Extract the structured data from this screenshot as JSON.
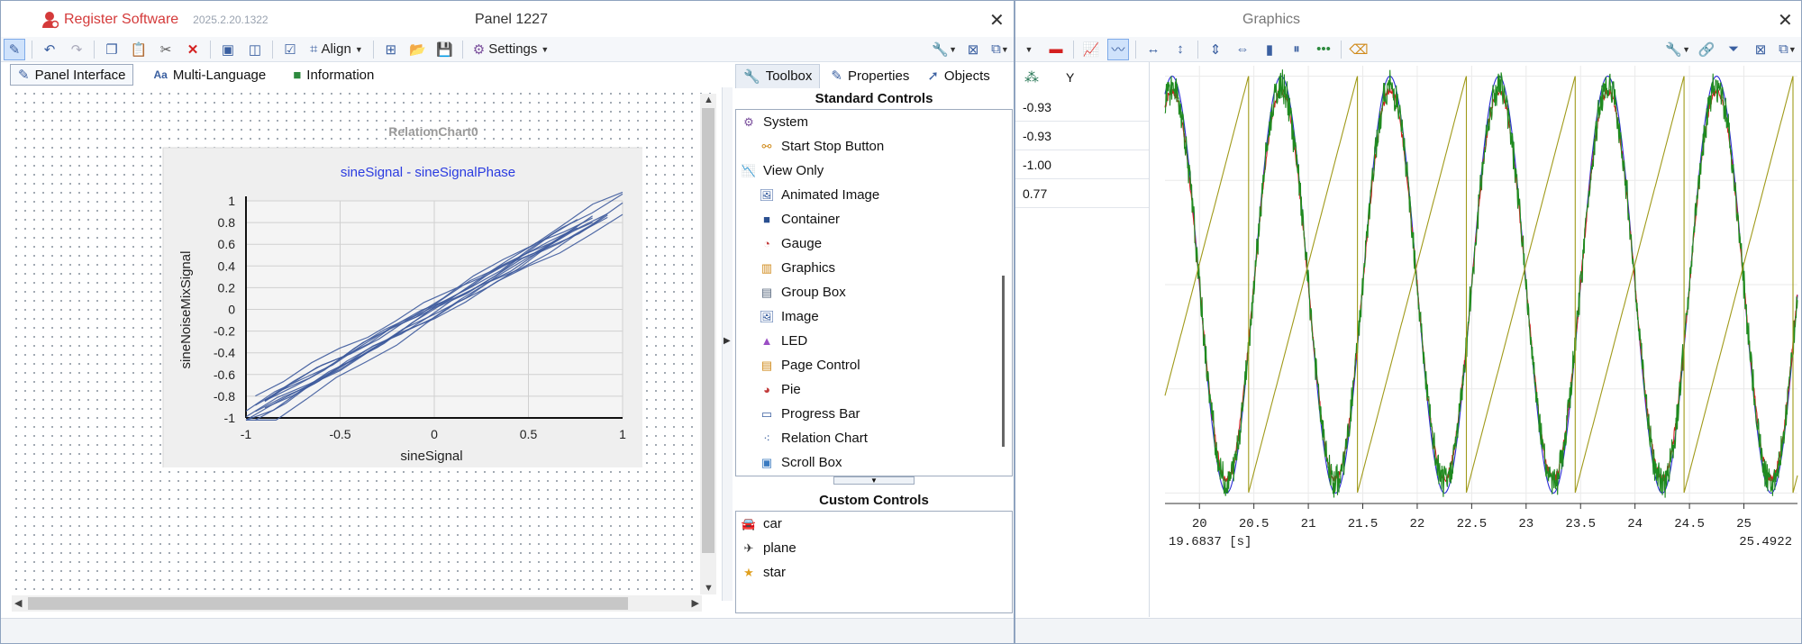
{
  "left": {
    "app_name": "Register Software",
    "version": "2025.2.20.1322",
    "panel_title": "Panel 1227",
    "align_label": "Align",
    "settings_label": "Settings",
    "tabs": [
      "Panel Interface",
      "Multi-Language",
      "Information"
    ],
    "chart": {
      "component_name": "RelationChart0",
      "title": "sineSignal - sineSignalPhase",
      "xlabel": "sineSignal",
      "ylabel": "sineNoiseMixSignal"
    },
    "toolbox": {
      "tabs": [
        "Toolbox",
        "Properties",
        "Objects"
      ],
      "standard_header": "Standard Controls",
      "standard_items": [
        {
          "label": "System",
          "icon": "gear-icon",
          "indent": 0
        },
        {
          "label": "Start Stop Button",
          "icon": "link-icon",
          "indent": 1
        },
        {
          "label": "View Only",
          "icon": "chart-line-icon",
          "indent": 0
        },
        {
          "label": "Animated Image",
          "icon": "image-icon",
          "indent": 1
        },
        {
          "label": "Container",
          "icon": "square-icon",
          "indent": 1
        },
        {
          "label": "Gauge",
          "icon": "gauge-icon",
          "indent": 1
        },
        {
          "label": "Graphics",
          "icon": "bar-chart-icon",
          "indent": 1
        },
        {
          "label": "Group Box",
          "icon": "groupbox-icon",
          "indent": 1
        },
        {
          "label": "Image",
          "icon": "image-icon",
          "indent": 1
        },
        {
          "label": "LED",
          "icon": "led-icon",
          "indent": 1
        },
        {
          "label": "Page Control",
          "icon": "tabs-icon",
          "indent": 1
        },
        {
          "label": "Pie",
          "icon": "pie-icon",
          "indent": 1
        },
        {
          "label": "Progress Bar",
          "icon": "progress-icon",
          "indent": 1
        },
        {
          "label": "Relation Chart",
          "icon": "scatter-icon",
          "indent": 1
        },
        {
          "label": "Scroll Box",
          "icon": "scrollbox-icon",
          "indent": 1
        }
      ],
      "custom_header": "Custom Controls",
      "custom_items": [
        {
          "label": "car",
          "icon": "car-icon"
        },
        {
          "label": "plane",
          "icon": "plane-icon"
        },
        {
          "label": "star",
          "icon": "star-icon"
        }
      ]
    }
  },
  "right": {
    "title": "Graphics",
    "table_header_y": "Y",
    "table_values": [
      "-0.93",
      "-0.93",
      "-1.00",
      "0.77"
    ],
    "x_start": "19.6837 [s]",
    "x_end": "25.4922"
  },
  "chart_data": [
    {
      "type": "line",
      "title": "sineSignal - sineSignalPhase",
      "xlabel": "sineSignal",
      "ylabel": "sineNoiseMixSignal",
      "xlim": [
        -1,
        1
      ],
      "ylim": [
        -1,
        1
      ],
      "x_ticks": [
        "-1",
        "-0.5",
        "0",
        "0.5",
        "1"
      ],
      "y_ticks": [
        "1",
        "0.8",
        "0.6",
        "0.4",
        "0.2",
        "0",
        "-0.2",
        "-0.4",
        "-0.6",
        "-0.8",
        "-1"
      ],
      "series": [
        {
          "points": [
            [
              -1,
              -0.96
            ],
            [
              -0.5,
              -0.5
            ],
            [
              0,
              0.02
            ],
            [
              0.5,
              0.52
            ],
            [
              1,
              1.0
            ]
          ]
        }
      ],
      "grid": true,
      "color": "#3d5a9c"
    },
    {
      "type": "line",
      "xlim": [
        19.6837,
        25.4922
      ],
      "ylim": [
        -1.05,
        1.05
      ],
      "x_ticks": [
        "20",
        "20.5",
        "21",
        "21.5",
        "22",
        "22.5",
        "23",
        "23.5",
        "24",
        "24.5",
        "25"
      ],
      "frequency_hz": 1,
      "series": [
        {
          "color": "#2b2bd6",
          "kind": "sine",
          "amplitude": 1.0
        },
        {
          "color": "#d42020",
          "kind": "sine",
          "amplitude": 0.93
        },
        {
          "color": "#1f8a1f",
          "kind": "noisy-sine",
          "amplitude": 0.95
        },
        {
          "color": "#a09a1a",
          "kind": "sawtooth",
          "amplitude": 1.0
        }
      ],
      "grid": true
    }
  ]
}
